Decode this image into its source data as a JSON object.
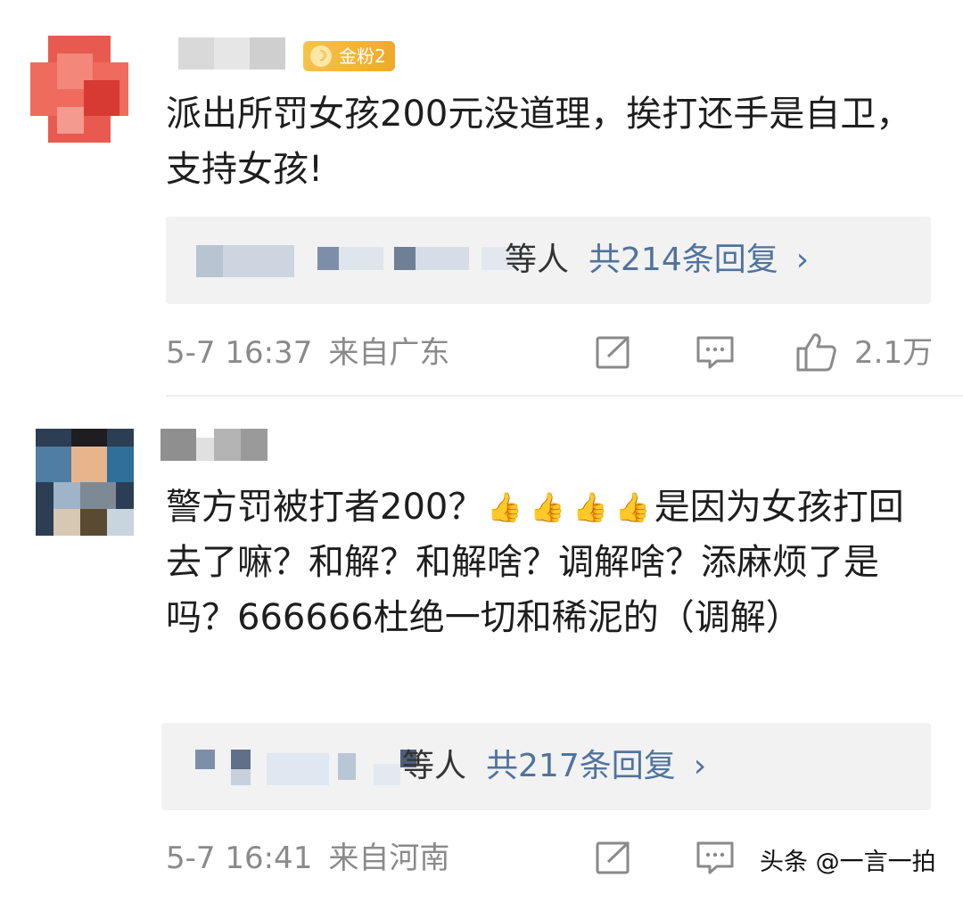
{
  "comments": [
    {
      "badge": "金粉2",
      "text": "派出所罚女孩200元没道理，挨打还手是自卫，支持女孩!",
      "reply_others": "等人",
      "reply_count": "共214条回复",
      "time": "5-7 16:37",
      "location": "来自广东",
      "likes": "2.1万"
    },
    {
      "text_before_emoji": "警方罚被打者200？",
      "emoji_count": 4,
      "text_after_emoji": "是因为女孩打回去了嘛？和解？和解啥？调解啥？添麻烦了是吗？666666杜绝一切和稀泥的（调解）",
      "reply_others": "等人",
      "reply_count": "共217条回复",
      "time": "5-7 16:41",
      "location": "来自河南"
    }
  ],
  "icons": {
    "repost": "share-square-icon",
    "comment": "comment-bubble-icon",
    "like": "thumbs-up-icon",
    "chevron": "chevron-right-icon",
    "emoji": "thumbs-up-emoji"
  },
  "chevron_glyph": "›",
  "emoji_glyph": "👍",
  "watermark": "头条 @一言一拍",
  "colors": {
    "link_blue": "#50739e",
    "meta_gray": "#8a8a8a",
    "reply_bg": "#f2f2f2",
    "badge_gold": "#f2b236"
  }
}
